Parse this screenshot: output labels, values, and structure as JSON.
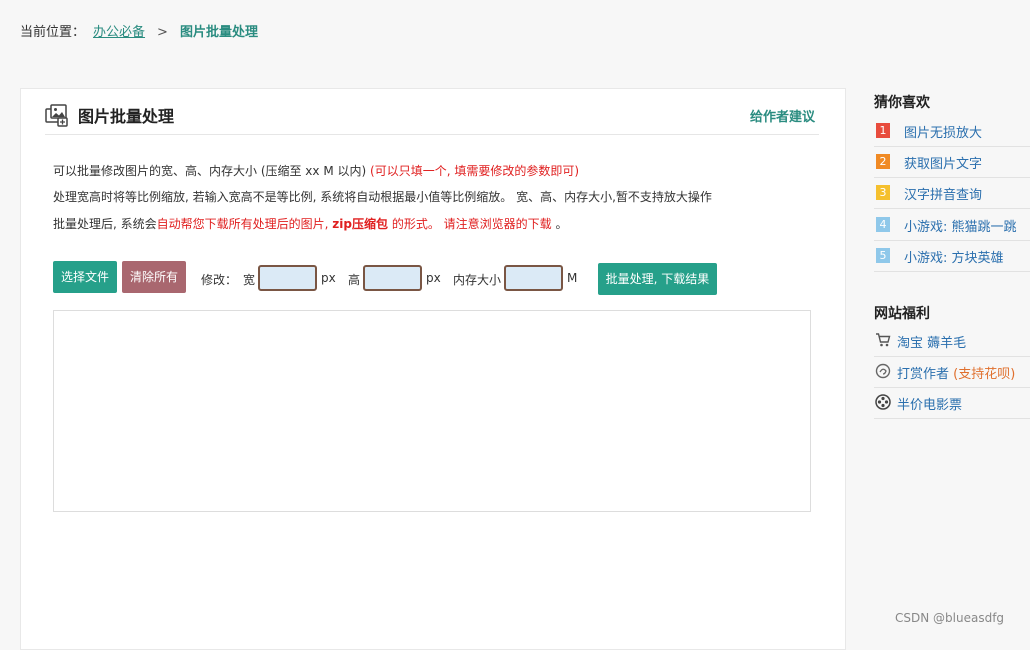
{
  "breadcrumb": {
    "prefix": "当前位置：",
    "parent": "办公必备",
    "separator": ">",
    "current": "图片批量处理"
  },
  "panel": {
    "title": "图片批量处理",
    "suggest": "给作者建议",
    "desc1_main": "可以批量修改图片的宽、高、内存大小 (压缩至 xx M 以内)",
    "desc1_note": "(可以只填一个, 填需要修改的参数即可)",
    "desc2": "处理宽高时将等比例缩放, 若输入宽高不是等比例, 系统将自动根据最小值等比例缩放。 宽、高、内存大小,暂不支持放大操作",
    "desc3_pre": "批量处理后, 系统会",
    "desc3_red1": "自动帮您下载所有处理后的图片,",
    "desc3_bold": "zip压缩包",
    "desc3_red2": "的形式。 请注意浏览器的下载",
    "desc3_end": "。"
  },
  "toolbar": {
    "choose_label": "选择文件",
    "clear_label": "清除所有",
    "modify_label": "修改：",
    "width_label": "宽",
    "width_unit": "px",
    "height_label": "高",
    "height_unit": "px",
    "size_label": "内存大小",
    "size_unit": "M",
    "batch_label": "批量处理, 下载结果",
    "width_value": "",
    "height_value": "",
    "size_value": ""
  },
  "sidebar": {
    "guess_title": "猜你喜欢",
    "guess_items": [
      {
        "num": "1",
        "label": "图片无损放大",
        "color": "#e84c3d"
      },
      {
        "num": "2",
        "label": "获取图片文字",
        "color": "#f08a24"
      },
      {
        "num": "3",
        "label": "汉字拼音查询",
        "color": "#f5c02e"
      },
      {
        "num": "4",
        "label": "小游戏: 熊猫跳一跳",
        "color": "#8fc8ea"
      },
      {
        "num": "5",
        "label": "小游戏: 方块英雄",
        "color": "#8fc8ea"
      }
    ],
    "perks_title": "网站福利",
    "perks": [
      {
        "label": "淘宝 薅羊毛",
        "extra": "",
        "icon": "cart-icon"
      },
      {
        "label": "打赏作者",
        "extra": "(支持花呗)",
        "icon": "reward-icon"
      },
      {
        "label": "半价电影票",
        "extra": "",
        "icon": "film-reel-icon"
      }
    ]
  },
  "watermark": "CSDN @blueasdfg"
}
